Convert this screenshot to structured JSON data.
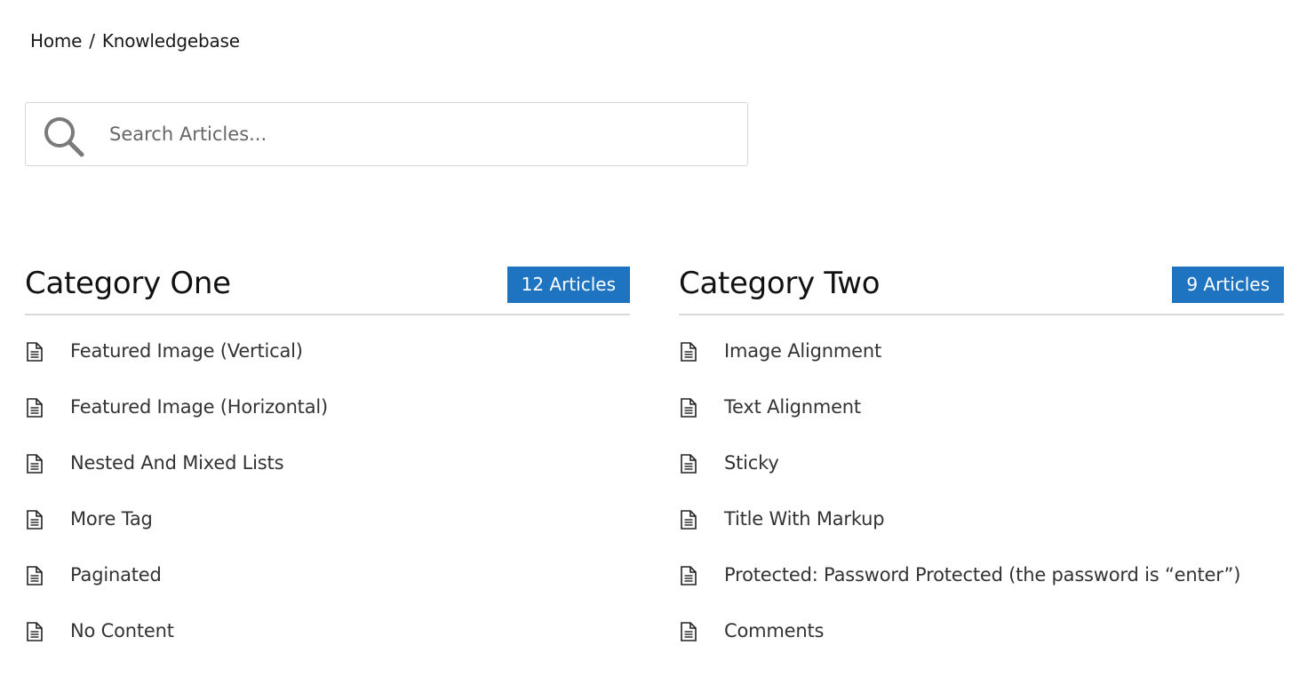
{
  "breadcrumb": {
    "home": "Home",
    "separator": "/",
    "current": "Knowledgebase"
  },
  "search": {
    "placeholder": "Search Articles...",
    "value": "",
    "icon": "search-icon"
  },
  "categories": [
    {
      "title": "Category One",
      "count_label": "12 Articles",
      "articles": [
        {
          "title": "Featured Image (Vertical)",
          "icon": "document-icon"
        },
        {
          "title": "Featured Image (Horizontal)",
          "icon": "document-icon"
        },
        {
          "title": "Nested And Mixed Lists",
          "icon": "document-icon"
        },
        {
          "title": "More Tag",
          "icon": "document-icon"
        },
        {
          "title": "Paginated",
          "icon": "document-icon"
        },
        {
          "title": "No Content",
          "icon": "document-icon"
        }
      ]
    },
    {
      "title": "Category Two",
      "count_label": "9 Articles",
      "articles": [
        {
          "title": "Image Alignment",
          "icon": "document-icon"
        },
        {
          "title": "Text Alignment",
          "icon": "document-icon"
        },
        {
          "title": "Sticky",
          "icon": "document-icon"
        },
        {
          "title": "Title With Markup",
          "icon": "document-icon"
        },
        {
          "title": "Protected: Password Protected (the password is “enter”)",
          "icon": "document-icon"
        },
        {
          "title": "Comments",
          "icon": "document-icon"
        }
      ]
    }
  ],
  "colors": {
    "accent": "#1f74c1",
    "divider": "#d9d9d9",
    "text": "#333333"
  }
}
